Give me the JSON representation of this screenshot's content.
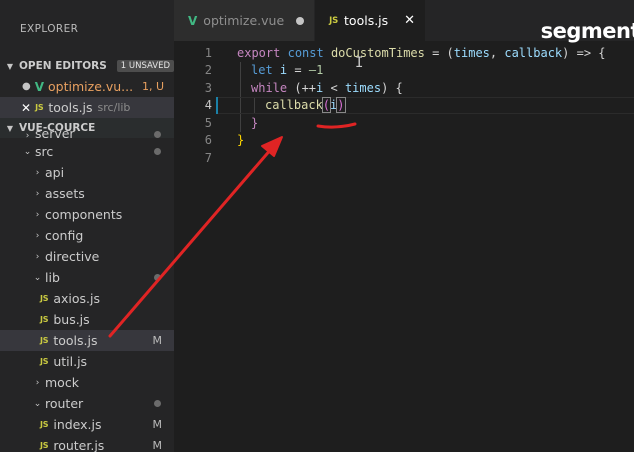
{
  "sidebar": {
    "title": "EXPLORER",
    "open_editors": {
      "header": "OPEN EDITORS",
      "badge": "1 UNSAVED",
      "items": [
        {
          "name": "optimize.vu...",
          "status": "1, U",
          "icon": "vue-icon",
          "lead": "unsaved-dot"
        },
        {
          "name": "tools.js",
          "path": "src/lib",
          "icon": "js-icon",
          "lead": "close-icon"
        }
      ]
    },
    "project": {
      "header": "VUE-COURCE",
      "items": [
        {
          "label": "server",
          "kind": "folder"
        },
        {
          "label": "src",
          "kind": "folder-open"
        },
        {
          "label": "api",
          "kind": "folder"
        },
        {
          "label": "assets",
          "kind": "folder"
        },
        {
          "label": "components",
          "kind": "folder"
        },
        {
          "label": "config",
          "kind": "folder"
        },
        {
          "label": "directive",
          "kind": "folder"
        },
        {
          "label": "lib",
          "kind": "folder-open"
        },
        {
          "label": "axios.js",
          "kind": "js"
        },
        {
          "label": "bus.js",
          "kind": "js"
        },
        {
          "label": "tools.js",
          "kind": "js",
          "status": "M"
        },
        {
          "label": "util.js",
          "kind": "js"
        },
        {
          "label": "mock",
          "kind": "folder"
        },
        {
          "label": "router",
          "kind": "folder-open"
        },
        {
          "label": "index.js",
          "kind": "js",
          "status": "M"
        },
        {
          "label": "router.js",
          "kind": "js",
          "status": "M"
        }
      ]
    }
  },
  "editor": {
    "tabs": [
      {
        "label": "optimize.vue",
        "icon": "vue-icon",
        "active": false,
        "dirty": true
      },
      {
        "label": "tools.js",
        "icon": "js-icon",
        "active": true,
        "dirty": false
      }
    ],
    "watermark": "segment",
    "line_numbers": [
      "1",
      "2",
      "3",
      "4",
      "5",
      "6",
      "7"
    ],
    "current_line": 4,
    "code": {
      "l1": {
        "export": "export",
        "const": "const",
        "name": "doCustomTimes",
        "eq": " = (",
        "p1": "times",
        "comma": ", ",
        "p2": "callback",
        "arrow": ") => {"
      },
      "l2": {
        "let": "let",
        "var": "i",
        "eq": " = ",
        "num": "–1"
      },
      "l3": {
        "while": "while",
        "open": " (++",
        "var": "i",
        "lt": " < ",
        "limit": "times",
        "close": ") {"
      },
      "l4": {
        "call": "callback",
        "open": "(",
        "arg": "i",
        "close": ")"
      },
      "l5": "}",
      "l6": "}"
    }
  },
  "colors": {
    "vue": "#41b883",
    "js": "#cbcb41",
    "annotation": "#e02424"
  }
}
